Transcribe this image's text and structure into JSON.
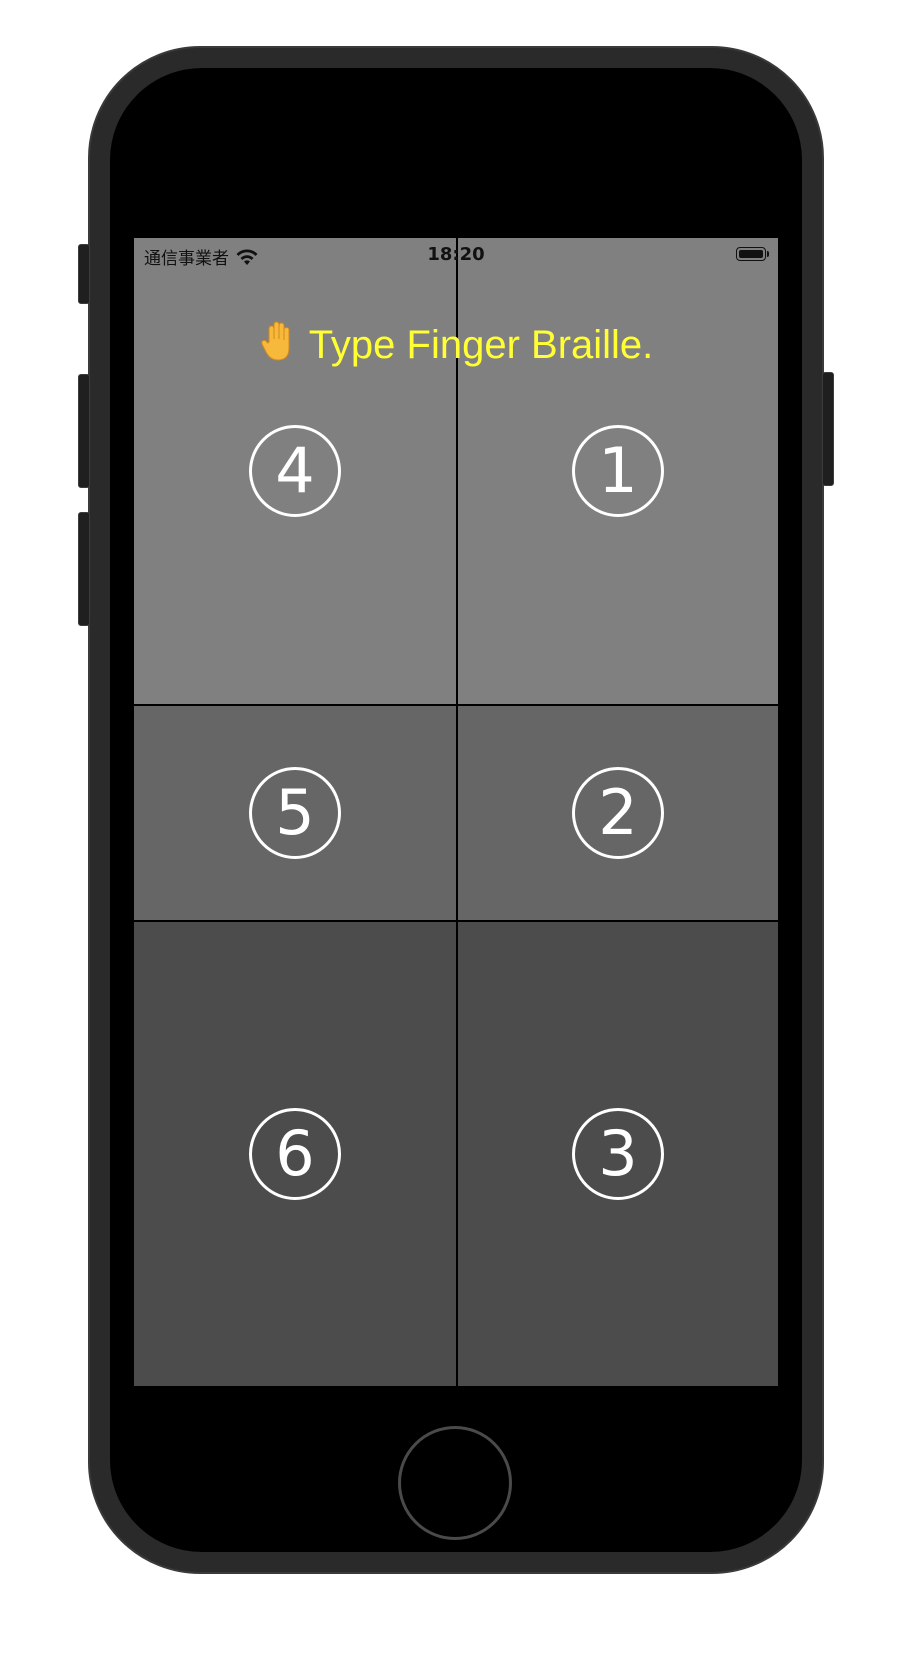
{
  "status_bar": {
    "carrier": "通信事業者",
    "time": "18:20",
    "wifi_icon": "wifi-icon",
    "battery_icon": "battery-icon"
  },
  "prompt": {
    "icon": "raised-hand-icon",
    "text": "Type Finger Braille."
  },
  "keys": [
    {
      "id": "4",
      "label": "4",
      "color": "#808080"
    },
    {
      "id": "1",
      "label": "1",
      "color": "#808080"
    },
    {
      "id": "5",
      "label": "5",
      "color": "#666666"
    },
    {
      "id": "2",
      "label": "2",
      "color": "#666666"
    },
    {
      "id": "6",
      "label": "6",
      "color": "#4c4c4c"
    },
    {
      "id": "3",
      "label": "3",
      "color": "#4c4c4c"
    }
  ],
  "colors": {
    "prompt_text": "#ffff33",
    "divider": "#000000",
    "key_text": "#ffffff"
  }
}
